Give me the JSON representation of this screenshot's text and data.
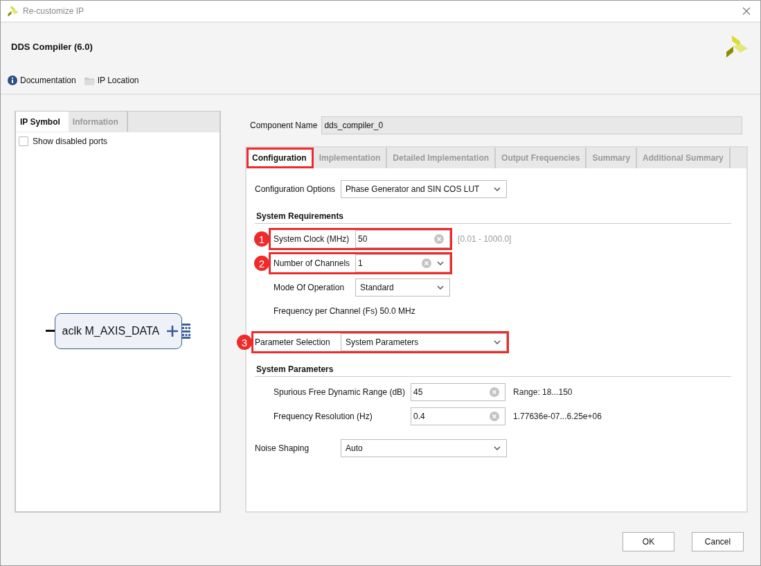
{
  "window": {
    "title": "Re-customize IP"
  },
  "header": {
    "title": "DDS Compiler (6.0)",
    "links": [
      {
        "label": "Documentation"
      },
      {
        "label": "IP Location"
      }
    ]
  },
  "left_panel": {
    "tabs": [
      {
        "label": "IP Symbol",
        "selected": true
      },
      {
        "label": "Information",
        "selected": false
      }
    ],
    "show_disabled_ports": {
      "label": "Show disabled ports",
      "checked": false
    },
    "symbol": {
      "label": "aclk M_AXIS_DATA"
    }
  },
  "component_name": {
    "label": "Component Name",
    "value": "dds_compiler_0"
  },
  "tabs": [
    {
      "label": "Configuration",
      "selected": true,
      "highlighted": true
    },
    {
      "label": "Implementation",
      "selected": false,
      "highlighted": false
    },
    {
      "label": "Detailed Implementation",
      "selected": false,
      "highlighted": false
    },
    {
      "label": "Output Frequencies",
      "selected": false,
      "highlighted": false
    },
    {
      "label": "Summary",
      "selected": false,
      "highlighted": false
    },
    {
      "label": "Additional Summary",
      "selected": false,
      "highlighted": false
    }
  ],
  "config": [
    {
      "kind": "dropdown",
      "label": "Configuration Options",
      "value": "Phase Generator and SIN COS LUT",
      "highlighted": false
    },
    {
      "kind": "section",
      "title": "System Requirements",
      "children": [
        {
          "kind": "field",
          "label": "System Clock (MHz)",
          "value": "50",
          "hint": "[0.01 - 1000.0]",
          "hint_muted": true,
          "highlighted": true,
          "marker": "1"
        },
        {
          "kind": "combo",
          "label": "Number of Channels",
          "value": "1",
          "highlighted": true,
          "marker": "2"
        },
        {
          "kind": "dropdown",
          "label": "Mode Of Operation",
          "value": "Standard",
          "highlighted": false
        },
        {
          "kind": "text",
          "text": "Frequency per Channel (Fs) 50.0 MHz"
        }
      ]
    },
    {
      "kind": "dropdown",
      "label": "Parameter Selection",
      "value": "System Parameters",
      "highlighted": true,
      "marker": "3"
    },
    {
      "kind": "section",
      "title": "System Parameters",
      "children": [
        {
          "kind": "field",
          "label": "Spurious Free Dynamic Range (dB)",
          "value": "45",
          "hint": "Range: 18...150",
          "hint_muted": false,
          "highlighted": false
        },
        {
          "kind": "field",
          "label": "Frequency Resolution (Hz)",
          "value": "0.4",
          "hint": "1.77636e-07...6.25e+06",
          "hint_muted": false,
          "highlighted": false
        }
      ]
    },
    {
      "kind": "dropdown",
      "label": "Noise Shaping",
      "value": "Auto",
      "highlighted": false
    }
  ],
  "buttons": [
    {
      "label": "OK"
    },
    {
      "label": "Cancel"
    }
  ]
}
